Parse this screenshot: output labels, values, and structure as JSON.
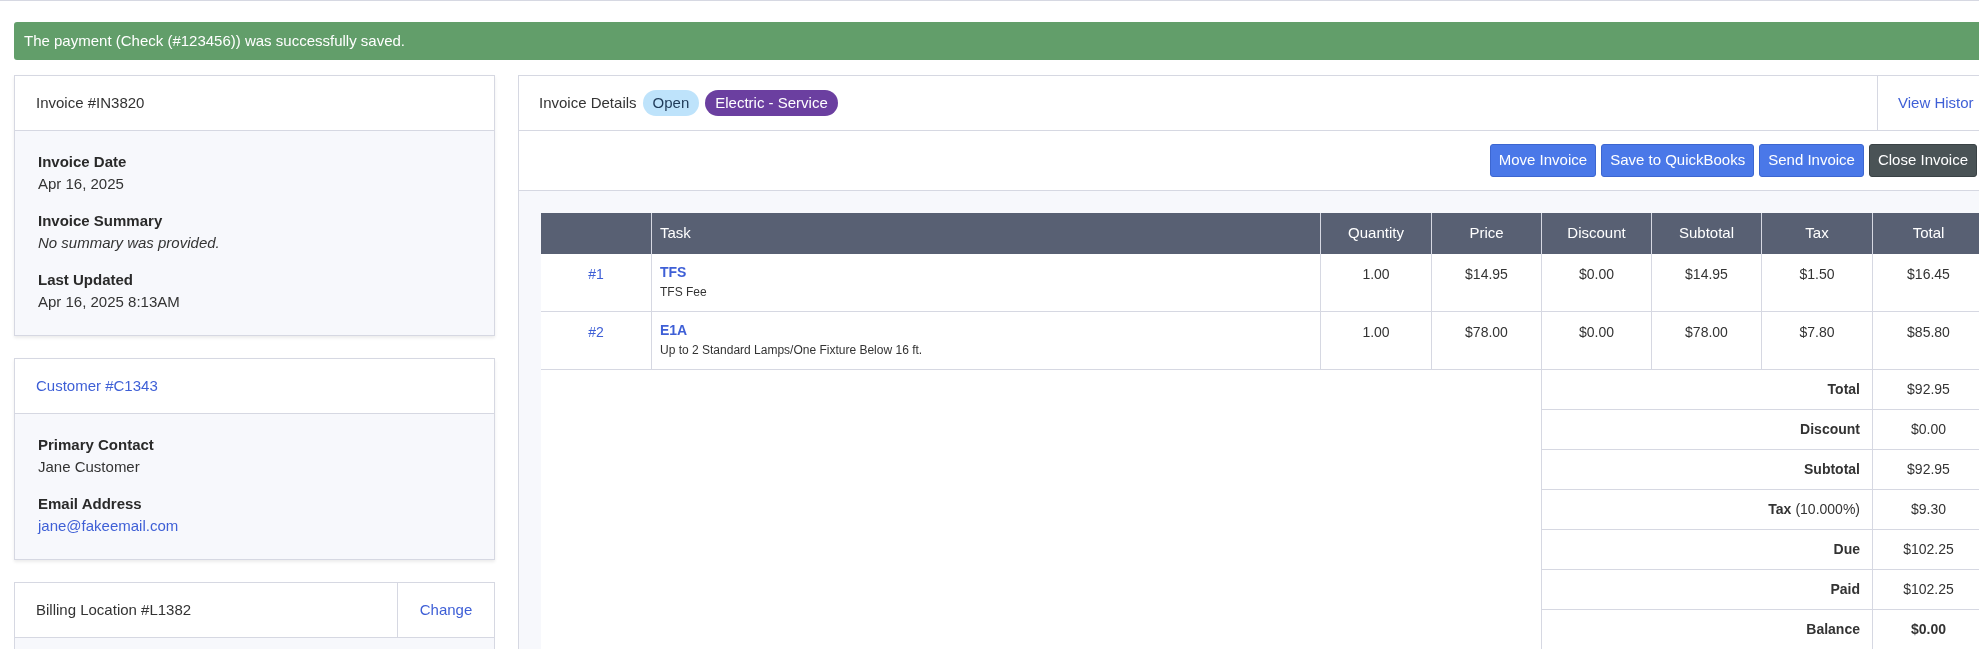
{
  "alert": {
    "text": "The payment (Check (#123456)) was successfully saved."
  },
  "invoice_card": {
    "title": "Invoice #IN3820",
    "fields": [
      {
        "label": "Invoice Date",
        "value": "Apr 16, 2025",
        "kind": "plain"
      },
      {
        "label": "Invoice Summary",
        "value": "No summary was provided.",
        "kind": "italic"
      },
      {
        "label": "Last Updated",
        "value": "Apr 16, 2025 8:13AM",
        "kind": "plain"
      }
    ]
  },
  "customer_card": {
    "title": "Customer #C1343",
    "fields": [
      {
        "label": "Primary Contact",
        "value": "Jane Customer",
        "kind": "plain"
      },
      {
        "label": "Email Address",
        "value": "jane@fakeemail.com",
        "kind": "link"
      }
    ]
  },
  "billing_card": {
    "title": "Billing Location #L1382",
    "action": "Change"
  },
  "details": {
    "title": "Invoice Details",
    "badges": [
      {
        "text": "Open",
        "color": "#bee3fb"
      },
      {
        "text": "Electric - Service",
        "color": "#6b3fa0"
      }
    ],
    "history_link": "View Histor",
    "buttons": [
      {
        "label": "Move Invoice",
        "kind": "primary"
      },
      {
        "label": "Save to QuickBooks",
        "kind": "primary"
      },
      {
        "label": "Send Invoice",
        "kind": "primary"
      },
      {
        "label": "Close Invoice",
        "kind": "dark"
      }
    ]
  },
  "table": {
    "columns": [
      "",
      "Task",
      "Quantity",
      "Price",
      "Discount",
      "Subtotal",
      "Tax",
      "Total"
    ],
    "rows": [
      {
        "cells": [
          {
            "kind": "link",
            "text": "#1"
          },
          {
            "kind": "task",
            "text": "TFS",
            "description": "TFS Fee"
          },
          {
            "kind": "plain",
            "text": "1.00"
          },
          {
            "kind": "plain",
            "text": "$14.95"
          },
          {
            "kind": "plain",
            "text": "$0.00"
          },
          {
            "kind": "plain",
            "text": "$14.95"
          },
          {
            "kind": "plain",
            "text": "$1.50"
          },
          {
            "kind": "plain",
            "text": "$16.45"
          }
        ]
      },
      {
        "cells": [
          {
            "kind": "link",
            "text": "#2"
          },
          {
            "kind": "task",
            "text": "E1A",
            "description": "Up to 2 Standard Lamps/One Fixture Below 16 ft."
          },
          {
            "kind": "plain",
            "text": "1.00"
          },
          {
            "kind": "plain",
            "text": "$78.00"
          },
          {
            "kind": "plain",
            "text": "$0.00"
          },
          {
            "kind": "plain",
            "text": "$78.00"
          },
          {
            "kind": "plain",
            "text": "$7.80"
          },
          {
            "kind": "plain",
            "text": "$85.80"
          }
        ]
      }
    ],
    "summary": [
      {
        "label": "Total",
        "value": "$92.95",
        "emphasis": false
      },
      {
        "label": "Discount",
        "value": "$0.00",
        "emphasis": false
      },
      {
        "label": "Subtotal",
        "value": "$92.95",
        "emphasis": false
      },
      {
        "label": "Tax",
        "note": "(10.000%)",
        "value": "$9.30",
        "emphasis": false
      },
      {
        "label": "Due",
        "value": "$102.25",
        "emphasis": false
      },
      {
        "label": "Paid",
        "value": "$102.25",
        "emphasis": false
      },
      {
        "label": "Balance",
        "value": "$0.00",
        "emphasis": true
      }
    ]
  }
}
